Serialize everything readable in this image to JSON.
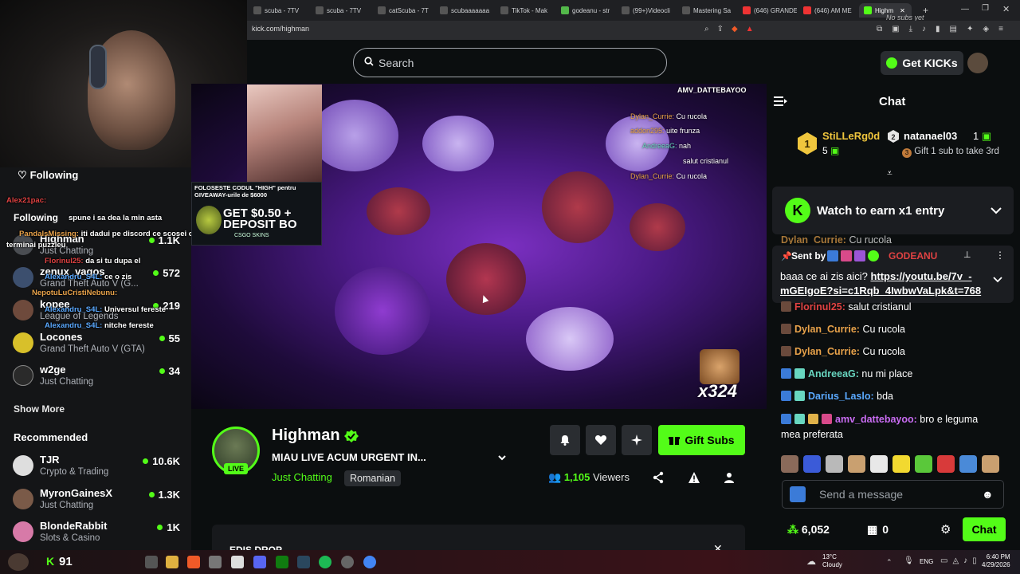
{
  "browser": {
    "tabs": [
      "scuba - 7TV",
      "scuba - 7TV",
      "catScuba - 7T",
      "scubaaaaaaa",
      "TikTok - Mak",
      "godeanu - str",
      "(99+)Videocli",
      "Mastering Sa",
      "(646) GRANDE",
      "(646) AM ME",
      "Highm"
    ],
    "url": "kick.com/highman",
    "no_subs": "No subs yet"
  },
  "sidebar": {
    "overlay_messages": [
      {
        "user": "Alex21pac:",
        "text": ""
      },
      {
        "user": "",
        "text": "spune i sa dea la min asta"
      },
      {
        "user": "PandaIsMissing:",
        "text": "iti dadui pe discord ce scosei coae da nu e tot ca nu"
      },
      {
        "user": "",
        "text": "terminai puzzleu"
      },
      {
        "user": "Florinul25:",
        "text": "da si tu dupa el"
      },
      {
        "user": "Alexandru_S4L:",
        "text": "ce o zis"
      },
      {
        "user": "NepotuLuCristiNebunu:",
        "text": ""
      },
      {
        "user": "Alexandru_S4L:",
        "text": "Universul fereste"
      },
      {
        "user": "Alexandru_S4L:",
        "text": "nitche fereste"
      }
    ],
    "following_label": "Following",
    "following": [
      {
        "name": "Highman",
        "category": "Just Chatting",
        "count": "1.1K"
      },
      {
        "name": "zenux_vagos",
        "category": "Grand Theft Auto V (G...",
        "count": "572"
      },
      {
        "name": "kopee",
        "category": "League of Legends",
        "count": "219"
      },
      {
        "name": "Locones",
        "category": "Grand Theft Auto V (GTA)",
        "count": "55"
      },
      {
        "name": "w2ge",
        "category": "Just Chatting",
        "count": "34"
      }
    ],
    "show_more": "Show More",
    "recommended_label": "Recommended",
    "recommended": [
      {
        "name": "TJR",
        "category": "Crypto & Trading",
        "count": "10.6K"
      },
      {
        "name": "MyronGainesX",
        "category": "Just Chatting",
        "count": "1.3K"
      },
      {
        "name": "BlondeRabbit",
        "category": "Slots & Casino",
        "count": "1K"
      }
    ]
  },
  "search": {
    "placeholder": "Search"
  },
  "video": {
    "ad_line": "FOLOSESTE CODUL \"HIGH\" pentru GIVEAWAY-urile de $6000",
    "ad_big1": "GET $0.50 +",
    "ad_big2": "DEPOSIT BO",
    "ad_small": "CSGO SKINS",
    "overlay_chat": [
      {
        "user": "AMV_DATTEBAYOO",
        "text": ""
      },
      {
        "user": "Dylan_Currie:",
        "text": "Cu rucola"
      },
      {
        "user": "addon295:",
        "text": "uite frunza"
      },
      {
        "user": "AndreeaG:",
        "text": "nah"
      },
      {
        "user": "",
        "text": "salut cristianul"
      },
      {
        "user": "Dylan_Currie:",
        "text": "Cu rucola"
      }
    ],
    "emote_count": "x324"
  },
  "stream": {
    "name": "Highman",
    "live": "LIVE",
    "title": "MIAU LIVE ACUM URGENT IN...",
    "category": "Just Chatting",
    "tag": "Romanian",
    "gift_label": "Gift Subs",
    "viewers_count": "1,105",
    "viewers_label": "Viewers",
    "drops_title": "EDIS DROP"
  },
  "chat": {
    "get_kicks": "Get KICKs",
    "title": "Chat",
    "top_gifters": [
      {
        "name": "StiLLeRg0d",
        "rank": "1",
        "count": "5"
      },
      {
        "name": "natanael03",
        "rank": "2",
        "count": "1"
      }
    ],
    "gift_cta": "Gift 1 sub to take 3rd",
    "watch_earn": "Watch to earn x1 entry",
    "pinned": {
      "sent_by": "Sent by",
      "user": "GODEANU",
      "text": "baaa ce ai zis aici? ",
      "link": "https://youtu.be/7v_-mGEIgoE?si=c1Rqb_4IwbwVaLpk&t=768"
    },
    "messages": [
      {
        "user": "Dylan_Currie:",
        "text": " Cu rucola",
        "color": "#e8a24a"
      },
      {
        "user": "Florinul25:",
        "text": " salut cristianul",
        "color": "#e04242"
      },
      {
        "user": "Dylan_Currie:",
        "text": " Cu rucola",
        "color": "#e8a24a"
      },
      {
        "user": "Dylan_Currie:",
        "text": " Cu rucola",
        "color": "#e8a24a"
      },
      {
        "user": "AndreeaG:",
        "text": " nu mi place",
        "color": "#68d6c0"
      },
      {
        "user": "Darius_Laslo:",
        "text": " bda",
        "color": "#5aa9ff"
      },
      {
        "user": "amv_dattebayoo:",
        "text": " bro e leguma",
        "color": "#c96cf2"
      },
      {
        "user": "",
        "text": "mea preferata",
        "color": "#ffffff"
      }
    ],
    "input_placeholder": "Send a message",
    "points": "6,052",
    "boxes": "0",
    "send_label": "Chat"
  },
  "taskbar": {
    "kick_count": "91",
    "weather": "13°C",
    "weather_desc": "Cloudy",
    "lang": "ENG",
    "time": "6:40 PM",
    "date": "4/29/2026"
  },
  "colors": {
    "accent": "#53fc18",
    "bg": "#0b0e0f",
    "panel": "#1b1d21"
  }
}
